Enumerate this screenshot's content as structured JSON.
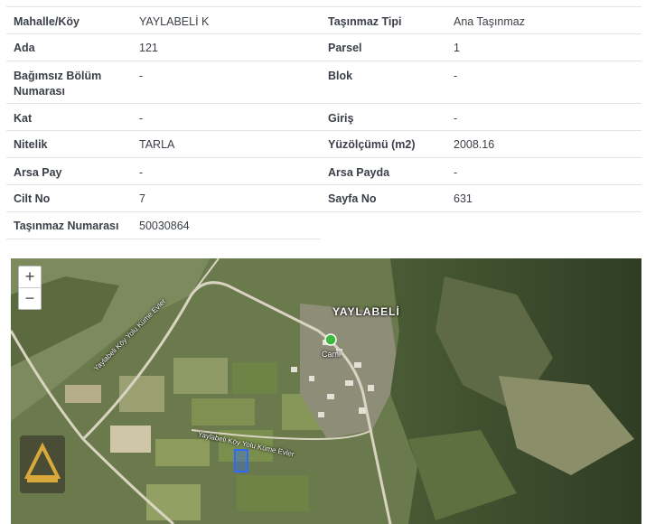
{
  "rows": [
    {
      "l1": "Mahalle/Köy",
      "v1": "YAYLABELİ K",
      "l2": "Taşınmaz Tipi",
      "v2": "Ana Taşınmaz"
    },
    {
      "l1": "Ada",
      "v1": "121",
      "l2": "Parsel",
      "v2": "1"
    },
    {
      "l1": "Bağımsız Bölüm",
      "l1b": "Numarası",
      "v1": "-",
      "l2": "Blok",
      "v2": "-"
    },
    {
      "l1": "Kat",
      "v1": "-",
      "l2": "Giriş",
      "v2": "-"
    },
    {
      "l1": "Nitelik",
      "v1": "TARLA",
      "l2": "Yüzölçümü (m2)",
      "v2": "2008.16"
    },
    {
      "l1": "Arsa Pay",
      "v1": "-",
      "l2": "Arsa Payda",
      "v2": "-"
    },
    {
      "l1": "Cilt No",
      "v1": "7",
      "l2": "Sayfa No",
      "v2": "631"
    },
    {
      "l1": "Taşınmaz Numarası",
      "v1": "50030864"
    }
  ],
  "map": {
    "zoom_in": "+",
    "zoom_out": "−",
    "village_label": "YAYLABELİ",
    "poi_label": "Cami",
    "road_label_1": "Yaylabeli Köy Yolu Küme Evler",
    "road_label_2": "Yaylabeli Köy Yolu Küme Evler",
    "colors": {
      "parcel": "#2d6bff",
      "poi": "#3cba3c"
    }
  }
}
